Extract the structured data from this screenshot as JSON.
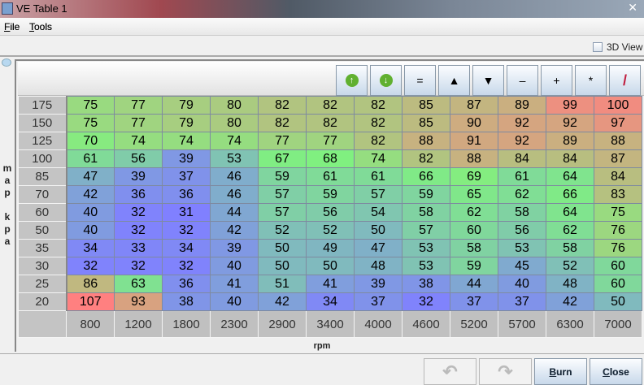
{
  "window": {
    "title": "VE Table 1",
    "close": "✕"
  },
  "menu": [
    {
      "label": "File",
      "mnemonic": "F",
      "rest": "ile"
    },
    {
      "label": "Tools",
      "mnemonic": "T",
      "rest": "ools"
    }
  ],
  "view3d": {
    "label": "3D View",
    "checked": false
  },
  "toolbar": [
    {
      "name": "increase-button",
      "icon": "green-up-arrow",
      "glyph": "↑"
    },
    {
      "name": "decrease-button",
      "icon": "green-down-arrow",
      "glyph": "↓"
    },
    {
      "name": "set-equal-button",
      "glyph": "="
    },
    {
      "name": "raise-button",
      "glyph": "▲"
    },
    {
      "name": "lower-button",
      "glyph": "▼"
    },
    {
      "name": "subtract-button",
      "glyph": "–"
    },
    {
      "name": "add-button",
      "glyph": "+"
    },
    {
      "name": "multiply-button",
      "glyph": "*"
    },
    {
      "name": "interpolate-button",
      "icon": "pencil-icon",
      "glyph": "/"
    }
  ],
  "table": {
    "y_label": "map kpa",
    "y_letters": [
      "m",
      "a",
      "p",
      "",
      "k",
      "p",
      "a"
    ],
    "x_label": "rpm",
    "y_axis": [
      175,
      150,
      125,
      100,
      85,
      70,
      60,
      50,
      35,
      30,
      25,
      20
    ],
    "x_axis": [
      800,
      1200,
      1800,
      2300,
      2900,
      3400,
      4000,
      4600,
      5200,
      5700,
      6300,
      7000
    ],
    "rows": [
      [
        75,
        77,
        79,
        80,
        82,
        82,
        82,
        85,
        87,
        89,
        99,
        100
      ],
      [
        75,
        77,
        79,
        80,
        82,
        82,
        82,
        85,
        90,
        92,
        92,
        97
      ],
      [
        70,
        74,
        74,
        74,
        77,
        77,
        82,
        88,
        91,
        92,
        89,
        88
      ],
      [
        61,
        56,
        39,
        53,
        67,
        68,
        74,
        82,
        88,
        84,
        84,
        87
      ],
      [
        47,
        39,
        37,
        46,
        59,
        61,
        61,
        66,
        69,
        61,
        64,
        84
      ],
      [
        42,
        36,
        36,
        46,
        57,
        59,
        57,
        59,
        65,
        62,
        66,
        83
      ],
      [
        40,
        32,
        31,
        44,
        57,
        56,
        54,
        58,
        62,
        58,
        64,
        75
      ],
      [
        40,
        32,
        32,
        42,
        52,
        52,
        50,
        57,
        60,
        56,
        62,
        76
      ],
      [
        34,
        33,
        34,
        39,
        50,
        49,
        47,
        53,
        58,
        53,
        58,
        76
      ],
      [
        32,
        32,
        32,
        40,
        50,
        50,
        48,
        53,
        59,
        45,
        52,
        60
      ],
      [
        86,
        63,
        36,
        41,
        51,
        41,
        39,
        38,
        44,
        40,
        48,
        60
      ],
      [
        107,
        93,
        38,
        40,
        42,
        34,
        37,
        32,
        37,
        37,
        42,
        50
      ]
    ]
  },
  "buttons": {
    "undo": "↶",
    "redo": "↷",
    "burn": "Burn",
    "burn_mn": "B",
    "burn_rest": "urn",
    "close": "Close",
    "close_mn": "C",
    "close_rest": "lose"
  },
  "colors": {
    "low": "#8080ff",
    "mid": "#80f080",
    "high": "#ff8080"
  }
}
